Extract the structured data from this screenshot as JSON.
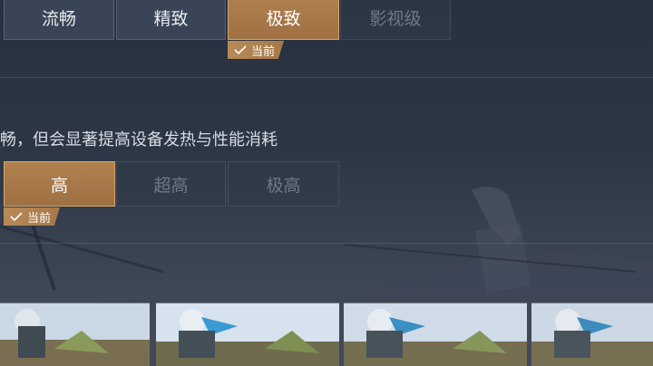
{
  "quality_row": {
    "options": [
      "流畅",
      "精致",
      "极致",
      "影视级"
    ],
    "selected_index": 2,
    "current_badge": "当前"
  },
  "description": "畅，但会显著提高设备发热与性能消耗",
  "framerate_row": {
    "options": [
      "高",
      "超高",
      "极高"
    ],
    "selected_index": 0,
    "current_badge": "当前"
  },
  "previews": {
    "count": 4
  },
  "colors": {
    "accent": "#a9784a",
    "accent_border": "#d9a56a",
    "text": "#e6e9ee",
    "text_disabled": "#6f7889"
  },
  "icons": {
    "badge_check": "check-icon"
  }
}
